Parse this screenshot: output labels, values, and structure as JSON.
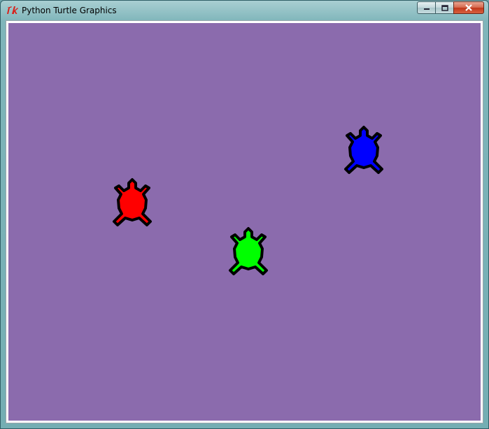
{
  "window": {
    "title": "Python Turtle Graphics",
    "app_icon": "tk-icon",
    "buttons": [
      "minimize-icon",
      "maximize-icon",
      "close-icon"
    ]
  },
  "canvas": {
    "background": "#8b6bad",
    "turtles": [
      {
        "name": "red-turtle",
        "color": "#ff0000",
        "heading": "up"
      },
      {
        "name": "green-turtle",
        "color": "#00ff00",
        "heading": "up"
      },
      {
        "name": "blue-turtle",
        "color": "#0000ff",
        "heading": "up"
      }
    ]
  }
}
